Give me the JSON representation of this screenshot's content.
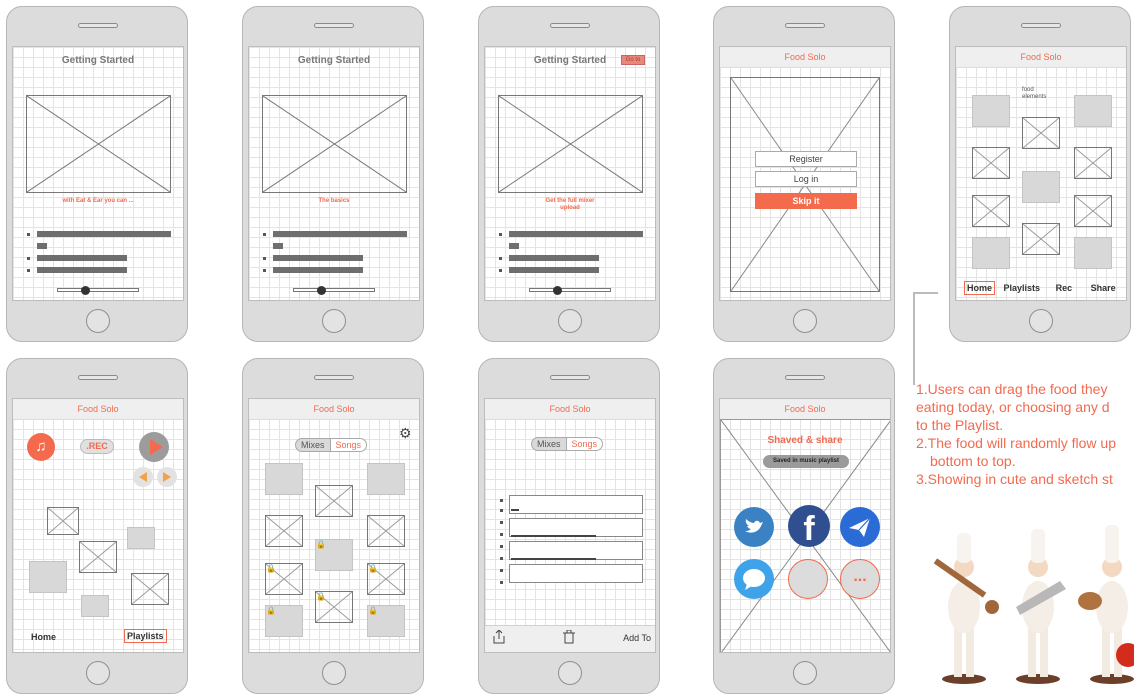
{
  "screens": {
    "s1": {
      "title": "Getting Started",
      "caption": "with Eat & Ear you can ..."
    },
    "s2": {
      "title": "Getting Started",
      "caption": "The basics"
    },
    "s3": {
      "title": "Getting Started",
      "caption": "Get the full mixer\nupload",
      "goto_label": "Go to"
    },
    "s4": {
      "app_title": "Food Solo",
      "register": "Register",
      "login": "Log in",
      "skip": "Skip it"
    },
    "s5": {
      "app_title": "Food Solo",
      "food_label": "food\nelements",
      "tabs": [
        "Home",
        "Playlists",
        "Rec",
        "Share"
      ],
      "selected_tab": "Home"
    },
    "s6": {
      "app_title": "Food Solo",
      "rec_label": ".REC",
      "home": "Home",
      "playlists": "Playlists"
    },
    "s7": {
      "app_title": "Food Solo",
      "seg_left": "Mixes",
      "seg_right": "Songs"
    },
    "s8": {
      "app_title": "Food Solo",
      "seg_left": "Mixes",
      "seg_right": "Songs",
      "add_to": "Add To"
    },
    "s9": {
      "app_title": "Food Solo",
      "heading": "Shaved & share",
      "saved_badge": "Saved in music playlist",
      "more_label": "..."
    }
  },
  "notes": {
    "line1": "1.Users can drag the food they",
    "line2": "eating today, or choosing any d",
    "line3": "to the Playlist.",
    "line4": "2.The food will randomly flow up",
    "line5": "bottom to top.",
    "line6": "3.Showing in cute and sketch st"
  },
  "colors": {
    "accent": "#f36a4d",
    "twitter": "#3b82c4",
    "facebook": "#2f4f90",
    "mail": "#2b6bd6",
    "chat": "#3ea3e8"
  },
  "icons": [
    "music-note-icon",
    "play-icon",
    "rewind-icon",
    "forward-icon",
    "gear-icon",
    "lock-icon",
    "share-icon",
    "trash-icon",
    "twitter-icon",
    "facebook-icon",
    "mail-icon",
    "chat-icon"
  ]
}
